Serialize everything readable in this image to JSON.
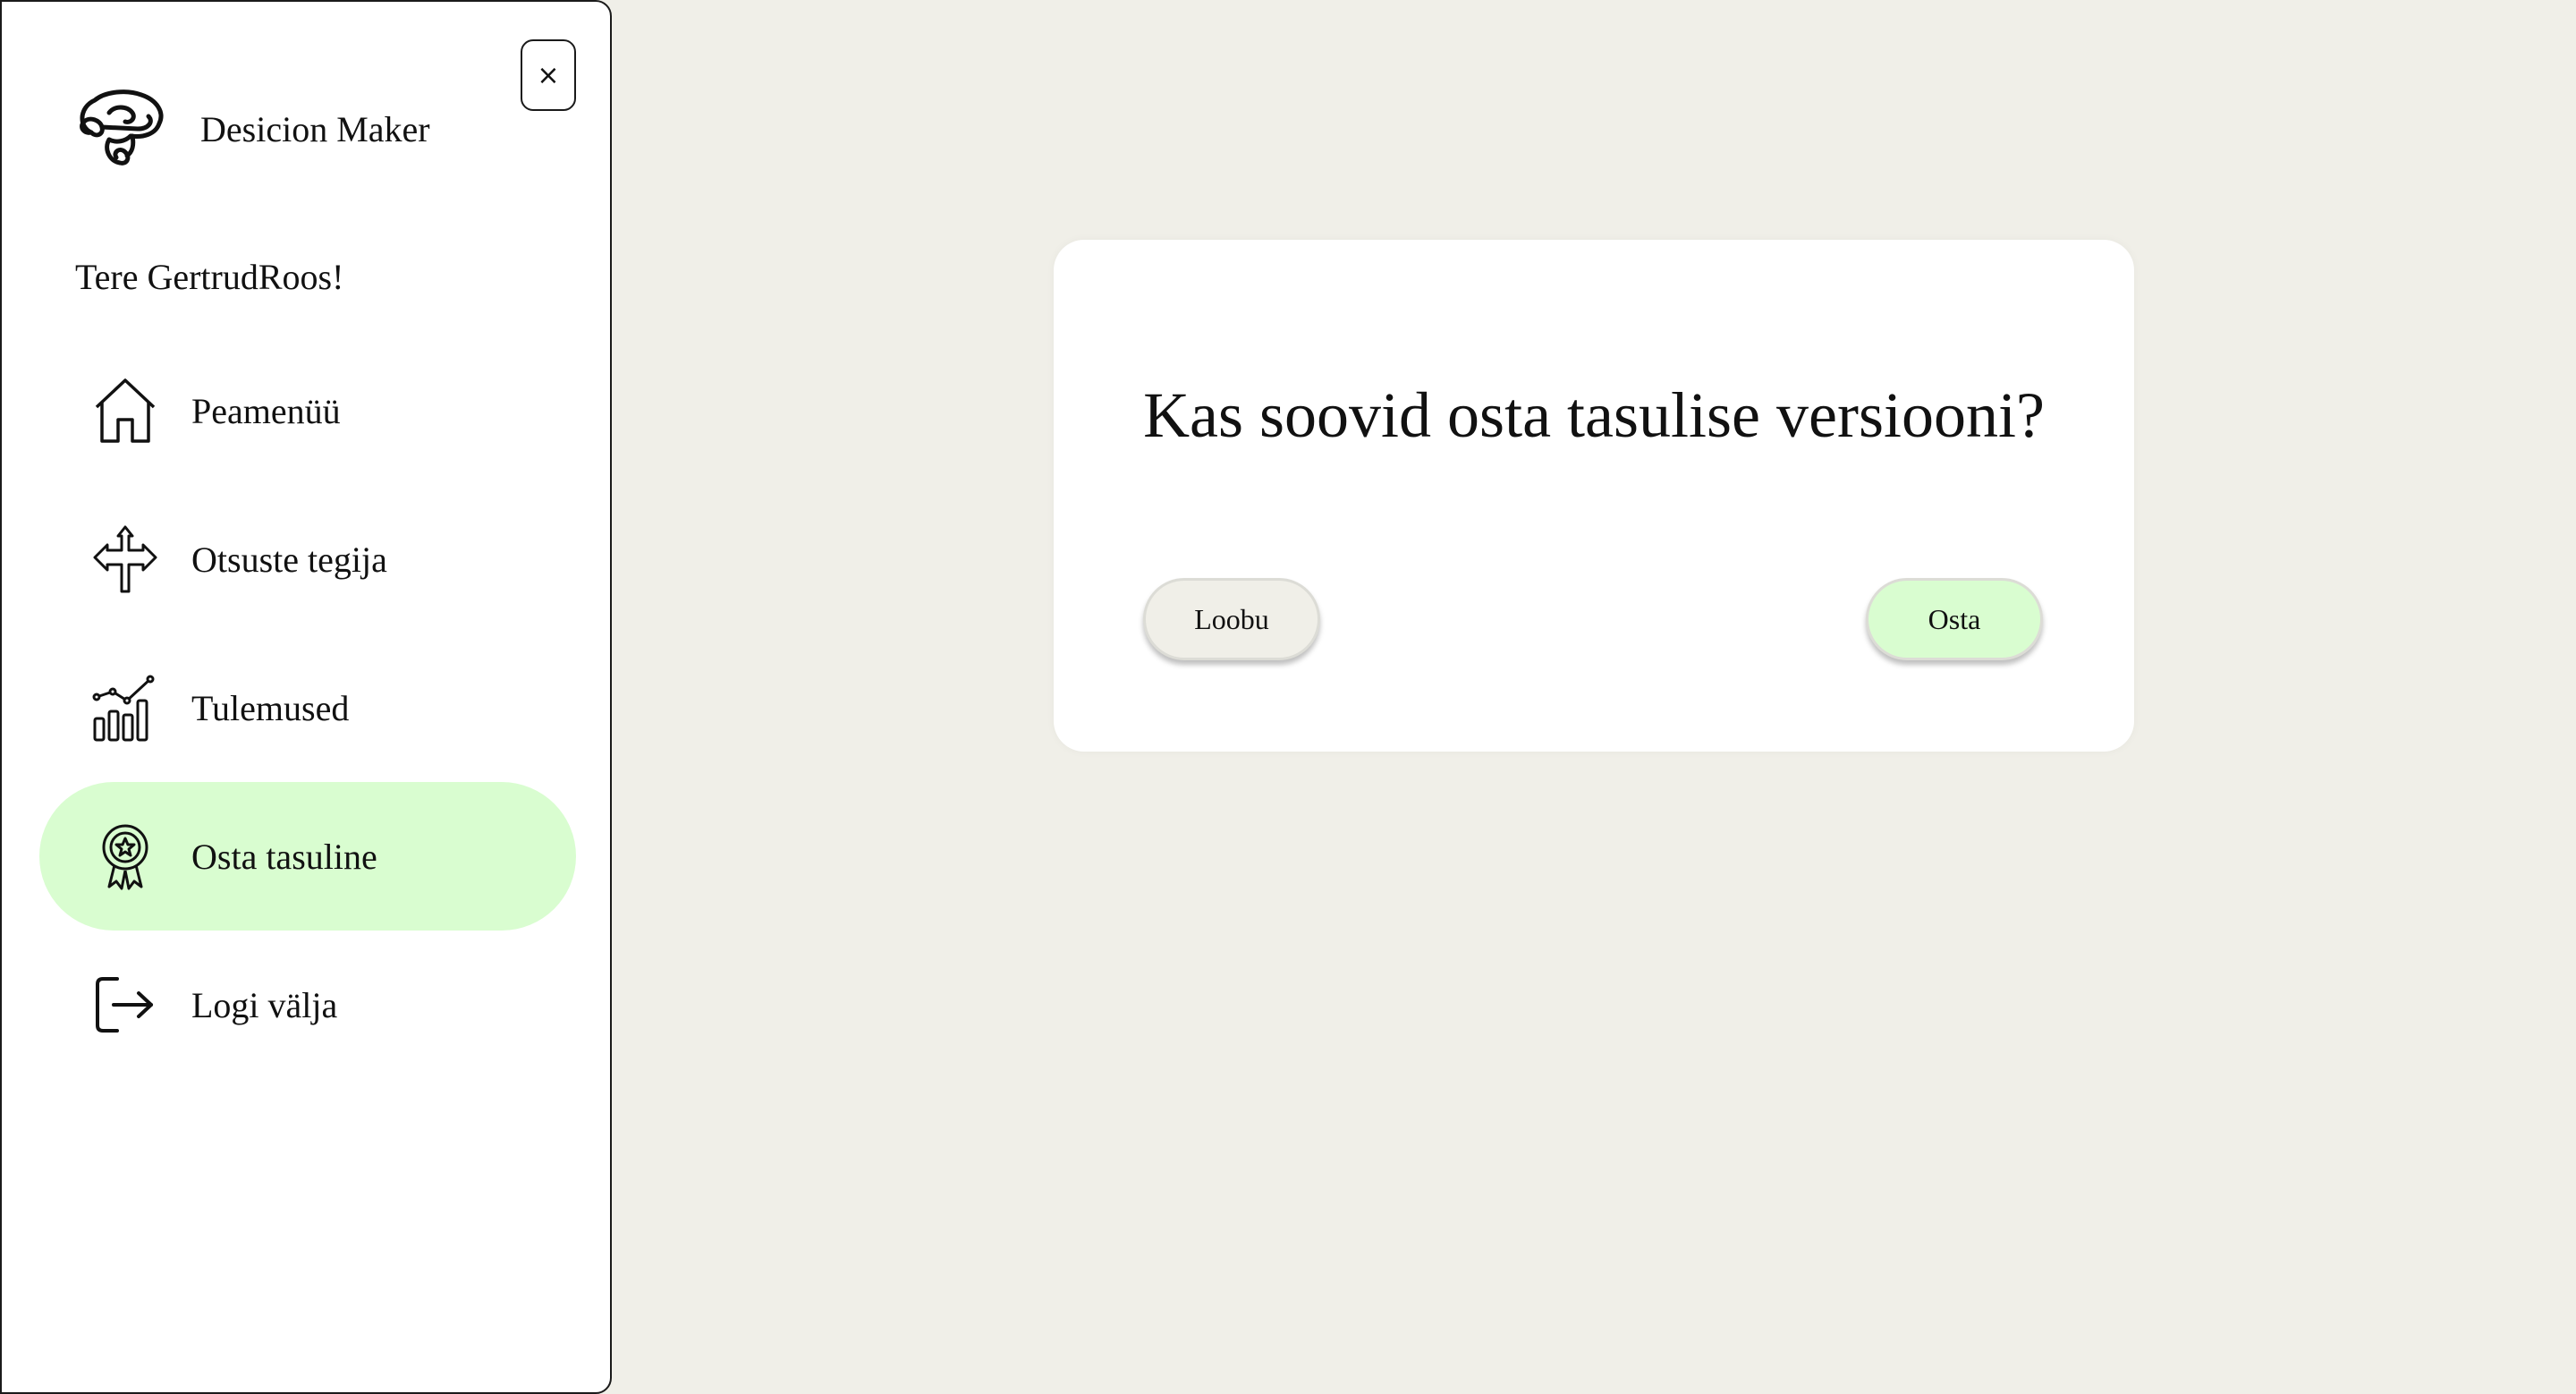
{
  "sidebar": {
    "close_label": "×",
    "brand_name": "Desicion Maker",
    "greeting": "Tere GertrudRoos!",
    "items": [
      {
        "label": "Peamenüü",
        "icon": "home-icon",
        "active": false
      },
      {
        "label": "Otsuste tegija",
        "icon": "split-arrows-icon",
        "active": false
      },
      {
        "label": "Tulemused",
        "icon": "bar-chart-icon",
        "active": false
      },
      {
        "label": "Osta tasuline",
        "icon": "award-badge-icon",
        "active": true
      },
      {
        "label": "Logi välja",
        "icon": "logout-icon",
        "active": false
      }
    ],
    "active_color": "#d9fdd0"
  },
  "dialog": {
    "title": "Kas soovid osta tasulise versiooni?",
    "cancel_label": "Loobu",
    "confirm_label": "Osta"
  },
  "colors": {
    "background": "#f0efe8",
    "accent": "#d9fdd0"
  }
}
